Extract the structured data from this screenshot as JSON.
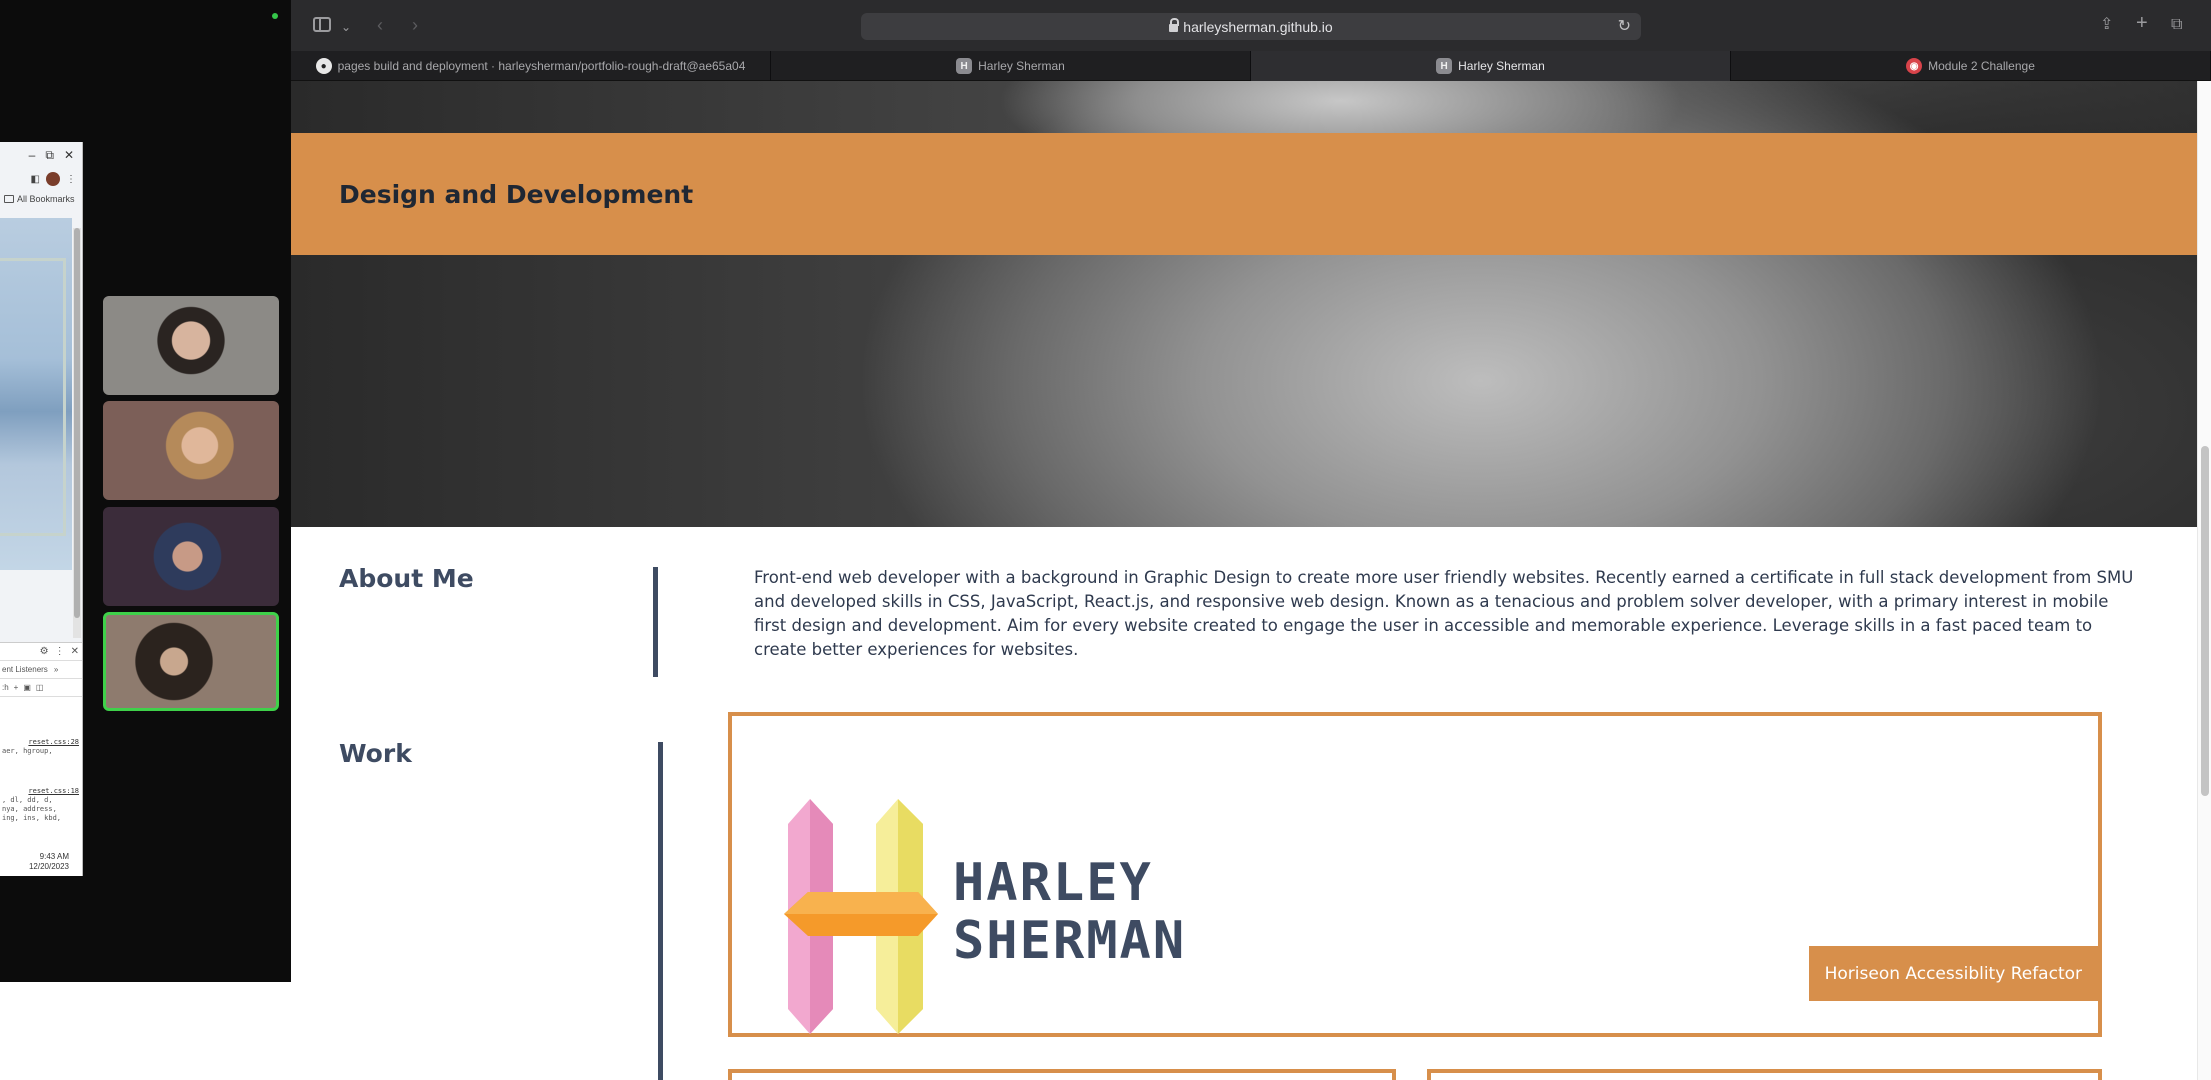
{
  "desktop": {
    "mini_window": {
      "bookmarks_label": "All Bookmarks",
      "devtools_tab": "ent Listeners",
      "devtools_link1": "reset.css:28",
      "devtools_line1": "aer, hgroup,",
      "devtools_link2": "reset.css:18",
      "devtools_line2": ", dl, dd, d,",
      "devtools_line3": "nya, address,",
      "devtools_line4": "ing, ins, kbd,",
      "time": "9:43 AM",
      "date": "12/20/2023"
    },
    "video_tiles": [
      "participant-1",
      "participant-2",
      "participant-3",
      "participant-4"
    ]
  },
  "browser": {
    "url": "harleysherman.github.io",
    "tabs": [
      {
        "label": "pages build and deployment · harleysherman/portfolio-rough-draft@ae65a04",
        "icon": "github-icon"
      },
      {
        "label": "Harley Sherman",
        "icon": "h-favicon-icon"
      },
      {
        "label": "Harley Sherman",
        "icon": "h-favicon-icon"
      },
      {
        "label": "Module 2 Challenge",
        "icon": "module-favicon-icon"
      }
    ]
  },
  "page": {
    "hero_title": "Design and Development",
    "about_heading": "About Me",
    "about_text": "Front-end web developer with a background in Graphic Design to create more user friendly websites. Recently earned a certificate in full stack development from SMU and developed skills in CSS, JavaScript, React.js, and responsive web design. Known as a tenacious and problem solver developer, with a primary interest in mobile first design and development. Aim for every website created to engage the user in accessible and memorable experience. Leverage skills in a fast paced team to create better experiences for websites.",
    "work_heading": "Work",
    "logo_line1": "HARLEY",
    "logo_line2": "SHERMAN",
    "project_label": "Horiseon Accessiblity Refactor"
  },
  "colors": {
    "accent": "#d78f4b",
    "heading": "#3e4b62",
    "toolbar": "#2b2b2d"
  }
}
